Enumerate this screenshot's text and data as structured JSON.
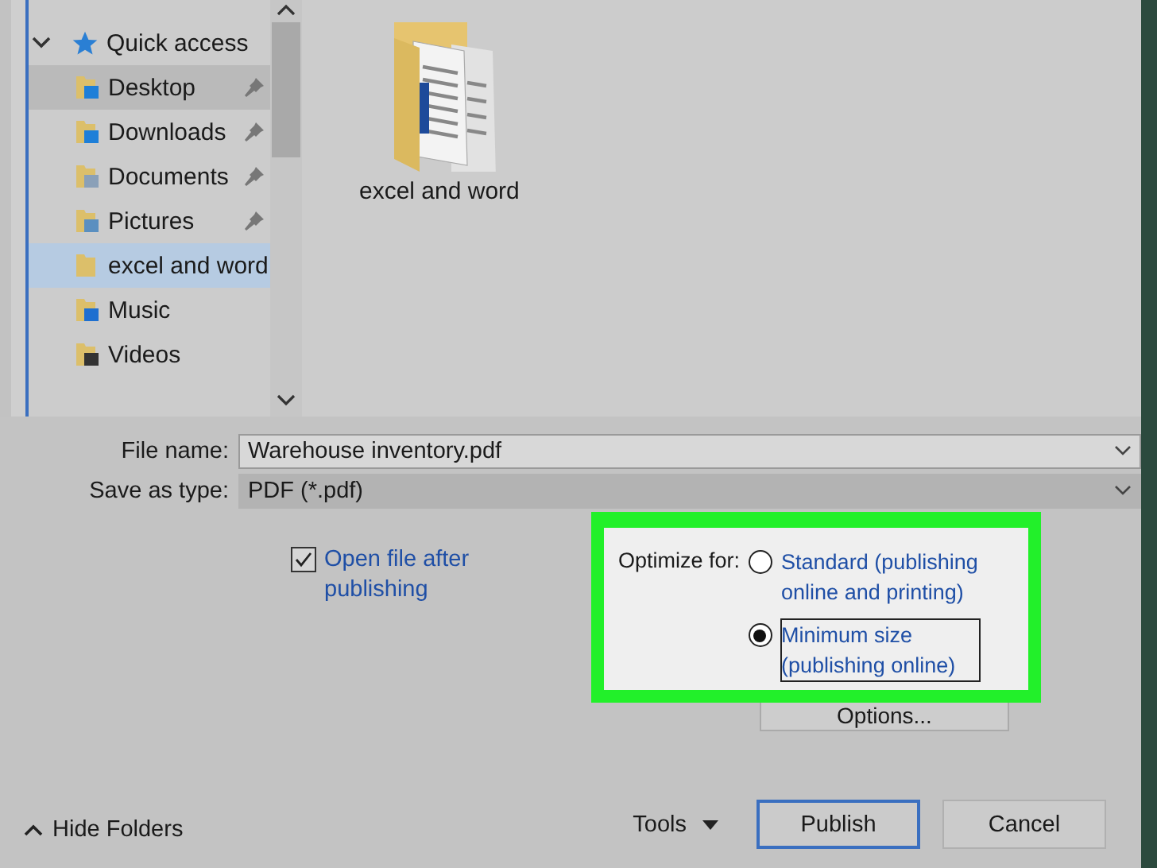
{
  "navigation": {
    "items": [
      {
        "label": "Quick access",
        "expanded": true,
        "children": [
          {
            "label": "Desktop",
            "pinned": true,
            "hovered": true,
            "selected": false
          },
          {
            "label": "Downloads",
            "pinned": true,
            "hovered": false,
            "selected": false
          },
          {
            "label": "Documents",
            "pinned": true,
            "hovered": false,
            "selected": false
          },
          {
            "label": "Pictures",
            "pinned": true,
            "hovered": false,
            "selected": false
          },
          {
            "label": "excel and word",
            "pinned": false,
            "hovered": false,
            "selected": true
          },
          {
            "label": "Music",
            "pinned": false,
            "hovered": false,
            "selected": false
          },
          {
            "label": "Videos",
            "pinned": false,
            "hovered": false,
            "selected": false
          }
        ]
      }
    ]
  },
  "content": {
    "items": [
      {
        "label": "excel and word"
      }
    ]
  },
  "form": {
    "file_name": {
      "label": "File name:",
      "value": "Warehouse inventory.pdf"
    },
    "save_as_type": {
      "label": "Save as type:",
      "value": "PDF (*.pdf)"
    },
    "open_after": {
      "label": "Open file after publishing",
      "checked": true
    },
    "optimize": {
      "label": "Optimize for:",
      "options": [
        {
          "label": "Standard (publishing online and printing)",
          "selected": false
        },
        {
          "label": "Minimum size (publishing online)",
          "selected": true
        }
      ]
    },
    "options_button": "Options..."
  },
  "footer": {
    "hide_folders": "Hide Folders",
    "tools": "Tools",
    "buttons": [
      {
        "label": "Publish",
        "default": true
      },
      {
        "label": "Cancel",
        "default": false
      }
    ]
  }
}
